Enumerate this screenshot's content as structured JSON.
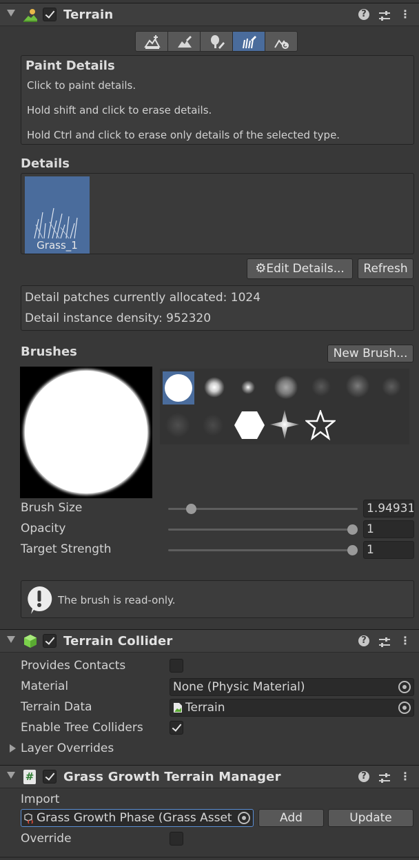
{
  "terrain": {
    "title": "Terrain",
    "enabled": true,
    "tools": [
      "raise-lower-icon",
      "paint-texture-icon",
      "paint-trees-icon",
      "paint-details-icon",
      "terrain-settings-icon"
    ],
    "active_tool_index": 3,
    "paint_details": {
      "heading": "Paint Details",
      "line1": "Click to paint details.",
      "line2": "Hold shift and click to erase details.",
      "line3": "Hold Ctrl and click to erase only details of the selected type."
    },
    "details": {
      "heading": "Details",
      "items": [
        {
          "label": "Grass_1"
        }
      ],
      "edit_button": "Edit Details...",
      "refresh_button": "Refresh"
    },
    "stats": {
      "allocated": "Detail patches currently allocated: 1024",
      "density": "Detail instance density: 952320"
    },
    "brushes": {
      "heading": "Brushes",
      "new_brush_button": "New Brush...",
      "brush_size_label": "Brush Size",
      "brush_size_value": "1.94931",
      "brush_size_fraction": 0.1,
      "opacity_label": "Opacity",
      "opacity_value": "1",
      "opacity_fraction": 1.0,
      "strength_label": "Target Strength",
      "strength_value": "1",
      "strength_fraction": 1.0,
      "readonly_message": "The brush is read-only."
    }
  },
  "collider": {
    "title": "Terrain Collider",
    "enabled": true,
    "provides_contacts_label": "Provides Contacts",
    "provides_contacts": false,
    "material_label": "Material",
    "material_value": "None (Physic Material)",
    "terrain_data_label": "Terrain Data",
    "terrain_data_value": "Terrain",
    "tree_colliders_label": "Enable Tree Colliders",
    "tree_colliders": true,
    "layer_overrides_label": "Layer Overrides"
  },
  "grass_manager": {
    "title": "Grass Growth Terrain Manager",
    "enabled": true,
    "import_label": "Import",
    "import_value": "Grass Growth Phase (Grass Asset",
    "add_button": "Add",
    "update_button": "Update",
    "override_label": "Override",
    "override": false
  },
  "colors": {
    "selection": "#4a6c9c",
    "background": "#383838"
  }
}
